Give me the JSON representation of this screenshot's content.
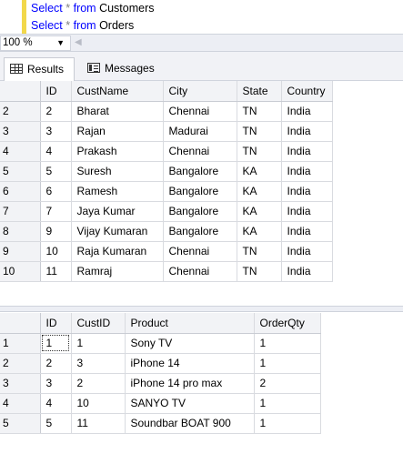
{
  "editor": {
    "line1": {
      "kw_select": "Select",
      "star": "*",
      "kw_from": "from",
      "table": "Customers"
    },
    "line2": {
      "kw_select": "Select",
      "star": "*",
      "kw_from": "from",
      "table": "Orders"
    }
  },
  "zoom": {
    "value": "100 %"
  },
  "tabs": {
    "results": "Results",
    "messages": "Messages"
  },
  "customers": {
    "columns": [
      "ID",
      "CustName",
      "City",
      "State",
      "Country"
    ],
    "rows": [
      {
        "rn": "2",
        "cells": [
          "2",
          "Bharat",
          "Chennai",
          "TN",
          "India"
        ]
      },
      {
        "rn": "3",
        "cells": [
          "3",
          "Rajan",
          "Madurai",
          "TN",
          "India"
        ]
      },
      {
        "rn": "4",
        "cells": [
          "4",
          "Prakash",
          "Chennai",
          "TN",
          "India"
        ]
      },
      {
        "rn": "5",
        "cells": [
          "5",
          "Suresh",
          "Bangalore",
          "KA",
          "India"
        ]
      },
      {
        "rn": "6",
        "cells": [
          "6",
          "Ramesh",
          "Bangalore",
          "KA",
          "India"
        ]
      },
      {
        "rn": "7",
        "cells": [
          "7",
          "Jaya Kumar",
          "Bangalore",
          "KA",
          "India"
        ]
      },
      {
        "rn": "8",
        "cells": [
          "9",
          "Vijay Kumaran",
          "Bangalore",
          "KA",
          "India"
        ]
      },
      {
        "rn": "9",
        "cells": [
          "10",
          "Raja Kumaran",
          "Chennai",
          "TN",
          "India"
        ]
      },
      {
        "rn": "10",
        "cells": [
          "11",
          "Ramraj",
          "Chennai",
          "TN",
          "India"
        ]
      }
    ]
  },
  "orders": {
    "columns": [
      "ID",
      "CustID",
      "Product",
      "OrderQty"
    ],
    "rows": [
      {
        "rn": "1",
        "cells": [
          "1",
          "1",
          "Sony TV",
          "1"
        ]
      },
      {
        "rn": "2",
        "cells": [
          "2",
          "3",
          "iPhone 14",
          "1"
        ]
      },
      {
        "rn": "3",
        "cells": [
          "3",
          "2",
          "iPhone 14 pro max",
          "2"
        ]
      },
      {
        "rn": "4",
        "cells": [
          "4",
          "10",
          "SANYO TV",
          "1"
        ]
      },
      {
        "rn": "5",
        "cells": [
          "5",
          "11",
          "Soundbar BOAT 900",
          "1"
        ]
      }
    ]
  },
  "colors": {
    "keyword": "#0000ff",
    "operator": "#808080",
    "marker": "#f2d84a"
  }
}
